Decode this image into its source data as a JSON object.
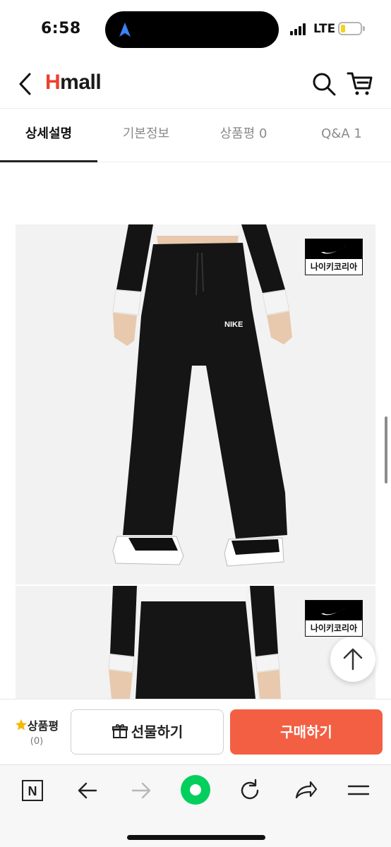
{
  "status": {
    "time": "6:58",
    "network": "LTE",
    "battery_level": 0.15,
    "battery_color": "#f4d21f"
  },
  "header": {
    "logo_h": "H",
    "logo_rest": "mall",
    "logo_color": "#ef3e2d"
  },
  "tabs": [
    {
      "label": "상세설명",
      "active": true
    },
    {
      "label": "기본정보",
      "active": false
    },
    {
      "label": "상품평 0",
      "active": false
    },
    {
      "label": "Q&A 1",
      "active": false
    }
  ],
  "product": {
    "brand_badge_label": "나이키코리아",
    "waistband_logo": "NIKE"
  },
  "purchase_bar": {
    "review_label": "상품평",
    "review_count": "(0)",
    "gift_label": "선물하기",
    "buy_label": "구매하기",
    "buy_color": "#f35f43"
  },
  "browser_toolbar": {
    "icons": [
      "naver-icon",
      "back-arrow-icon",
      "forward-arrow-icon",
      "green-dot-icon",
      "reload-icon",
      "share-icon",
      "menu-icon"
    ],
    "naver_letter": "N",
    "accent_color": "#03cf5d"
  }
}
